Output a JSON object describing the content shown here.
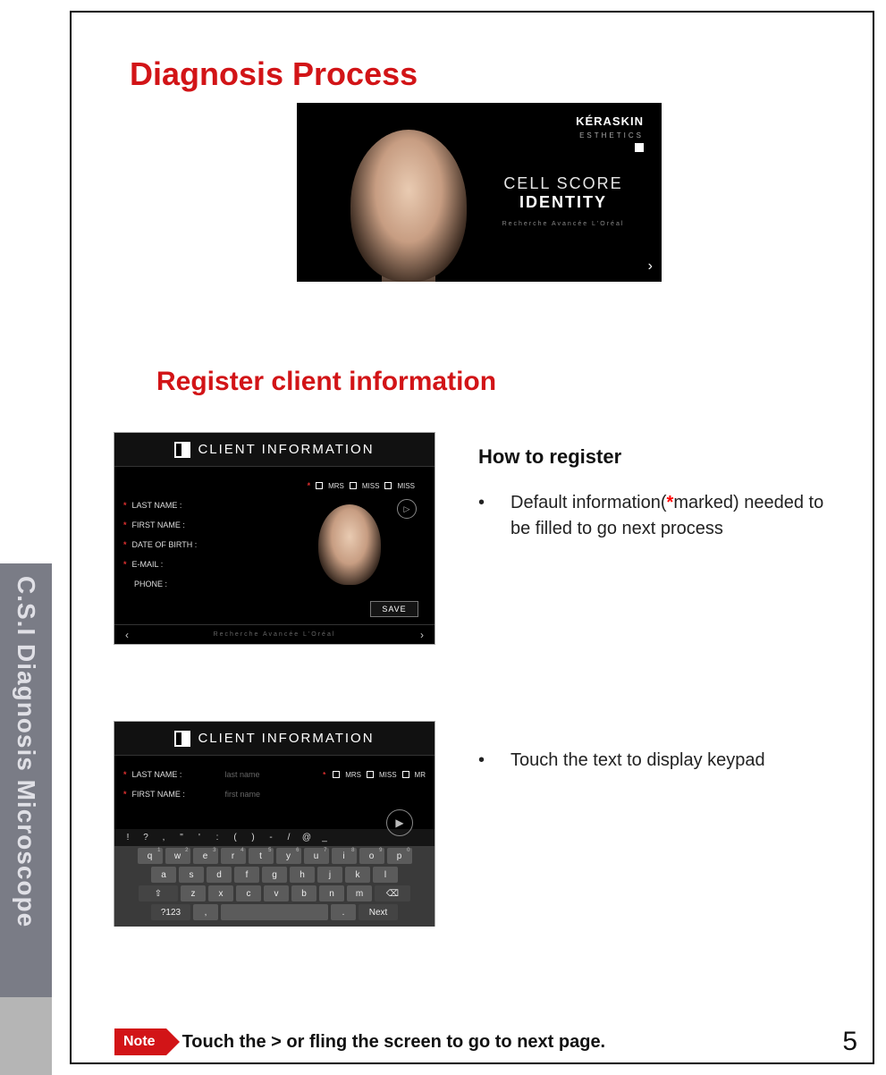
{
  "sidebar": {
    "label": "C.S.I Diagnosis Microscope"
  },
  "headings": {
    "main": "Diagnosis Process",
    "sub": "Register client information"
  },
  "hero": {
    "brand_top": "KÉRASKIN",
    "brand_sub": "ESTHETICS",
    "title_line1": "CELL SCORE",
    "title_line2": "IDENTITY",
    "subtitle": "Recherche  Avancée  L'Oréal",
    "next_icon": "›"
  },
  "panel_common": {
    "header_label": "CLIENT INFORMATION",
    "footer_tag": "Recherche  Avancée  L'Oréal",
    "prev_icon": "‹",
    "next_icon": "›"
  },
  "panel1": {
    "fields": {
      "last_name": "LAST NAME :",
      "first_name": "FIRST NAME :",
      "dob": "DATE OF BIRTH :",
      "email": "E-MAIL :",
      "phone": "PHONE :"
    },
    "titles": {
      "mrs": "MRS",
      "miss": "MISS",
      "miss2": "MISS"
    },
    "save": "SAVE",
    "play_icon": "▷"
  },
  "panel2": {
    "fields": {
      "last_name": "LAST NAME :",
      "first_name": "FIRST NAME :"
    },
    "placeholders": {
      "last_name": "last name",
      "first_name": "first name"
    },
    "titles": {
      "mrs": "MRS",
      "miss": "MISS",
      "mr": "MR"
    },
    "play_icon": "▶",
    "sym_row": [
      "!",
      "?",
      ",",
      "\"",
      "'",
      ":",
      "(",
      ")",
      "-",
      "/",
      "@",
      "_"
    ],
    "kbd_row1": [
      [
        "q",
        "1"
      ],
      [
        "w",
        "2"
      ],
      [
        "e",
        "3"
      ],
      [
        "r",
        "4"
      ],
      [
        "t",
        "5"
      ],
      [
        "y",
        "6"
      ],
      [
        "u",
        "7"
      ],
      [
        "i",
        "8"
      ],
      [
        "o",
        "9"
      ],
      [
        "p",
        "0"
      ]
    ],
    "kbd_row2": [
      "a",
      "s",
      "d",
      "f",
      "g",
      "h",
      "j",
      "k",
      "l"
    ],
    "kbd_row3_shift": "⇧",
    "kbd_row3": [
      "z",
      "x",
      "c",
      "v",
      "b",
      "n",
      "m"
    ],
    "kbd_row3_bksp": "⌫",
    "kbd_row4": {
      "numswitch": "?123",
      "comma": ",",
      "space": " ",
      "period": ".",
      "next": "Next"
    }
  },
  "right": {
    "howto_title": "How to register",
    "bullet1_pre": "Default information(",
    "bullet1_mark": "*",
    "bullet1_post": "marked) needed to be filled to go next process",
    "bullet2": "Touch the text to display keypad",
    "dot": "•"
  },
  "note": {
    "tag": "Note",
    "text": "Touch the  > or fling the screen to go to next  page."
  },
  "page_number": "5"
}
